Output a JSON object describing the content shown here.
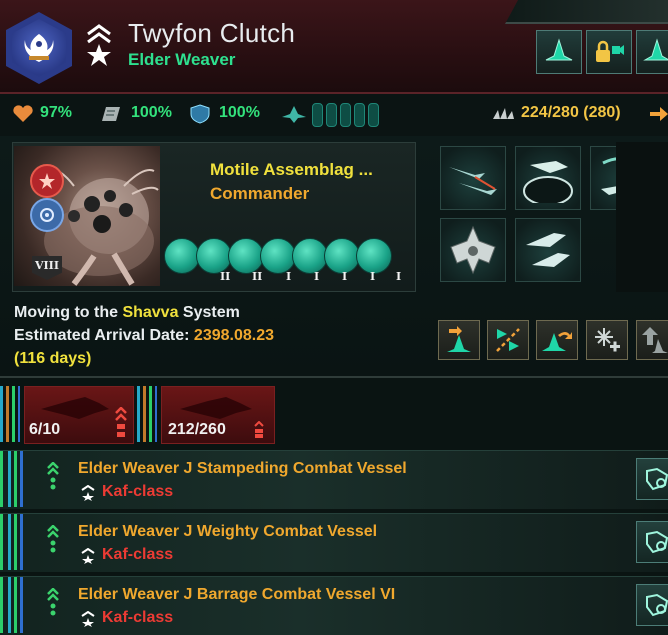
{
  "header": {
    "fleet_name": "Twyfon Clutch",
    "fleet_type": "Elder Weaver",
    "emblem_icon": "phoenix-emblem-icon",
    "rank_icon": "admiral-rank-icon",
    "buttons": [
      {
        "icon": "fleet-manager-icon"
      },
      {
        "icon": "lock-camera-icon"
      },
      {
        "icon": "fleet-options-icon"
      }
    ]
  },
  "stats": {
    "health": "97%",
    "armor": "100%",
    "shield": "100%",
    "naval_capacity": "224/280 (280)",
    "cloak_pips": 5,
    "colors": {
      "good": "#33e27c",
      "naval": "#f2c545"
    }
  },
  "commander": {
    "name": "Motile Assemblag ...",
    "role": "Commander",
    "level_badge": "VIII",
    "trait_ranks": [
      "II",
      "II",
      "I",
      "I",
      "I",
      "I",
      "I"
    ]
  },
  "ship_designs": [
    {
      "icon": "corvette-icon"
    },
    {
      "icon": "destroyer-icon"
    },
    {
      "icon": "cruiser-icon"
    },
    {
      "icon": "titan-icon"
    },
    {
      "icon": "frigate-icon"
    }
  ],
  "movement": {
    "line1_prefix": "Moving to the ",
    "system": "Shavva",
    "line1_suffix": " System",
    "arrival_label": "Estimated Arrival Date: ",
    "arrival_date": "2398.08.23",
    "days": "(116 days)"
  },
  "actions": [
    {
      "icon": "move-fleet-icon"
    },
    {
      "icon": "patrol-icon"
    },
    {
      "icon": "merge-fleet-icon"
    },
    {
      "icon": "reinforce-icon"
    },
    {
      "icon": "upgrade-icon"
    }
  ],
  "groups": [
    {
      "count": "6/10"
    },
    {
      "count": "212/260"
    }
  ],
  "rows": [
    {
      "name": "Elder Weaver J Stampeding Combat Vessel",
      "class": "Kaf-class"
    },
    {
      "name": "Elder Weaver J Weighty Combat Vessel",
      "class": "Kaf-class"
    },
    {
      "name": "Elder Weaver J Barrage Combat Vessel VI",
      "class": "Kaf-class"
    }
  ]
}
